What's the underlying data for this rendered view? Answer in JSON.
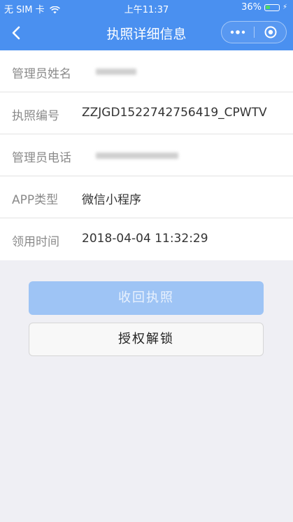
{
  "statusbar": {
    "carrier": "无 SIM 卡",
    "time": "上午11:37",
    "battery": "36%",
    "battery_level": 0.36
  },
  "navbar": {
    "title": "执照详细信息"
  },
  "fields": [
    {
      "label": "管理员姓名",
      "value": ""
    },
    {
      "label": "执照编号",
      "value": "ZZJGD1522742756419_CPWTV"
    },
    {
      "label": "管理员电话",
      "value": ""
    },
    {
      "label": "APP类型",
      "value": "微信小程序"
    },
    {
      "label": "领用时间",
      "value": "2018-04-04 11:32:29"
    }
  ],
  "buttons": {
    "revoke": "收回执照",
    "unlock": "授权解锁"
  },
  "colors": {
    "header": "#4a90f0",
    "primary_disabled": "#9ec4f5",
    "background": "#efeff4"
  }
}
